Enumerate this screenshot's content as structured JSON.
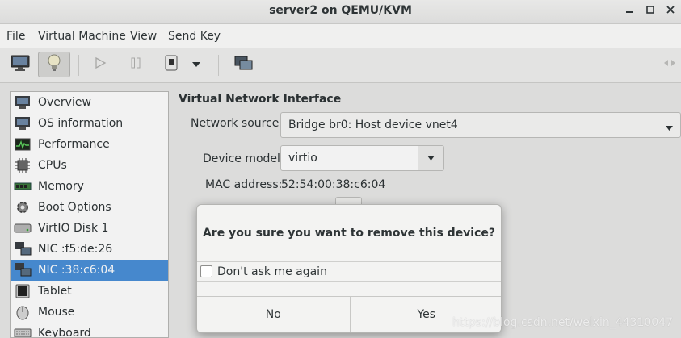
{
  "window": {
    "title": "server2 on QEMU/KVM"
  },
  "menubar": {
    "items": [
      "File",
      "Virtual Machine",
      "View",
      "Send Key"
    ]
  },
  "toolbar": {
    "buttons": [
      {
        "icon": "monitor-icon"
      },
      {
        "icon": "lightbulb-icon",
        "active": true
      },
      {
        "icon": "play-icon"
      },
      {
        "icon": "pause-icon"
      },
      {
        "icon": "power-icon"
      },
      {
        "icon": "dropdown-arrow-icon"
      },
      {
        "icon": "screens-icon"
      },
      {
        "icon": "resize-icon"
      }
    ]
  },
  "sidebar": {
    "items": [
      {
        "label": "Overview",
        "icon": "monitor-icon"
      },
      {
        "label": "OS information",
        "icon": "monitor-icon"
      },
      {
        "label": "Performance",
        "icon": "graph-icon"
      },
      {
        "label": "CPUs",
        "icon": "chip-icon"
      },
      {
        "label": "Memory",
        "icon": "memory-icon"
      },
      {
        "label": "Boot Options",
        "icon": "gear-icon"
      },
      {
        "label": "VirtIO Disk 1",
        "icon": "disk-icon"
      },
      {
        "label": "NIC :f5:de:26",
        "icon": "network-icon"
      },
      {
        "label": "NIC :38:c6:04",
        "icon": "network-icon",
        "selected": true
      },
      {
        "label": "Tablet",
        "icon": "tablet-icon"
      },
      {
        "label": "Mouse",
        "icon": "mouse-icon"
      },
      {
        "label": "Keyboard",
        "icon": "keyboard-icon"
      }
    ]
  },
  "details": {
    "section_title": "Virtual Network Interface",
    "network_source_label": "Network source:",
    "network_source_value": "Bridge br0: Host device vnet4",
    "device_model_label": "Device model:",
    "device_model_value": "virtio",
    "mac_label": "MAC address:",
    "mac_value": "52:54:00:38:c6:04"
  },
  "dialog": {
    "message": "Are you sure you want to remove this device?",
    "checkbox_label": "Don't ask me again",
    "checkbox_checked": false,
    "no_label": "No",
    "yes_label": "Yes"
  },
  "watermark": "https://blog.csdn.net/weixin_44310047",
  "colors": {
    "selection": "#4a90d9",
    "background": "#e8e8e7"
  }
}
